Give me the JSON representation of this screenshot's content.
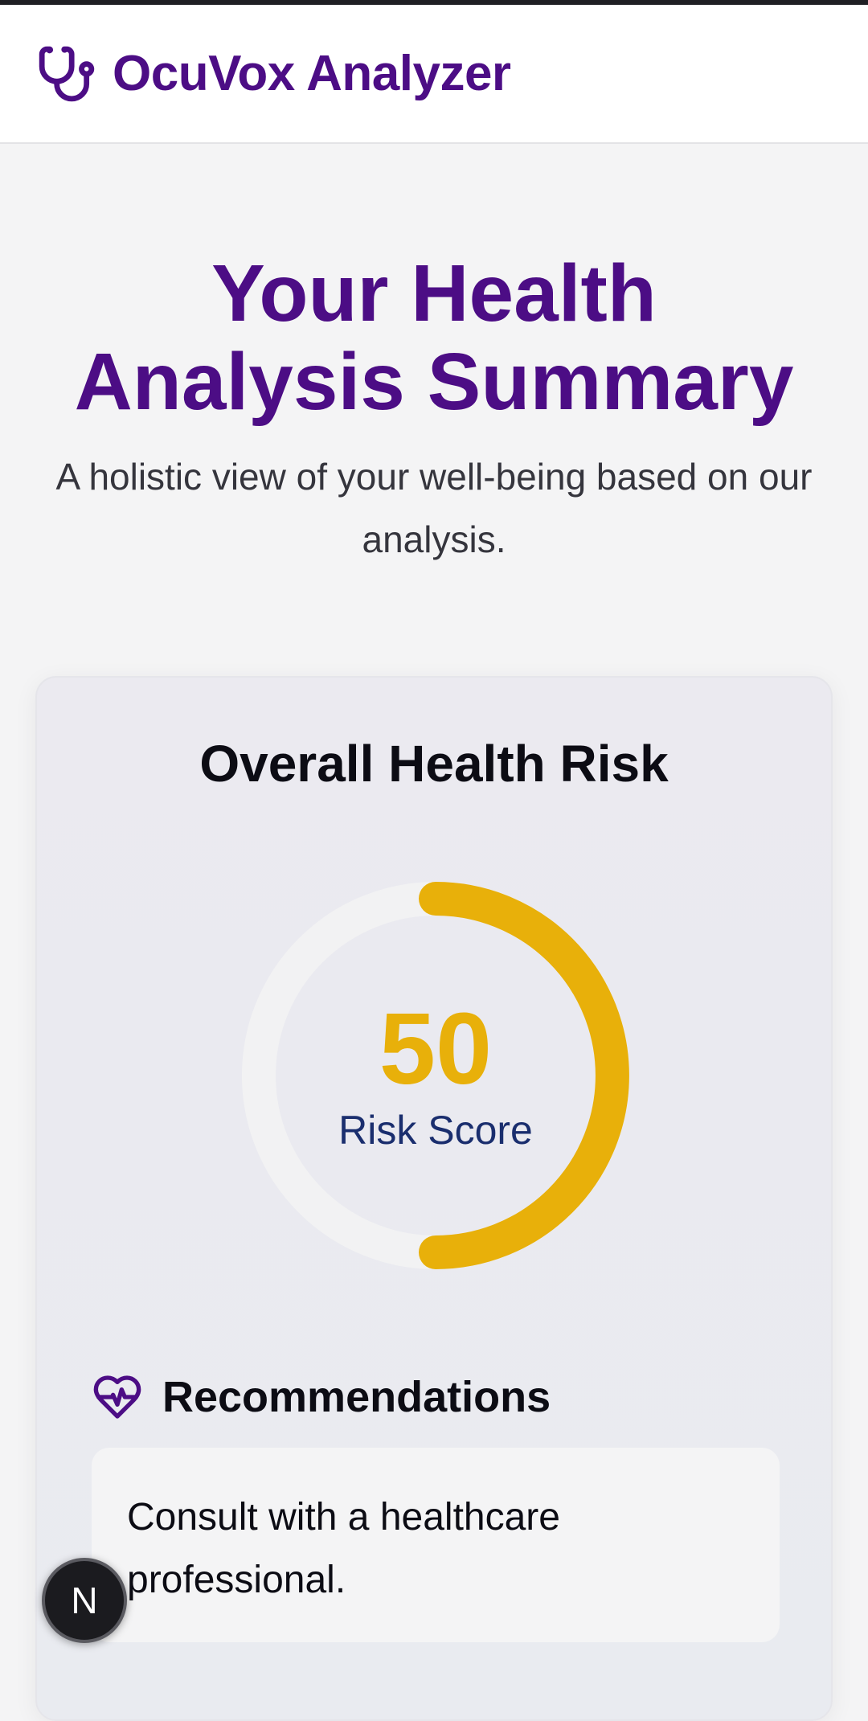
{
  "header": {
    "app_title": "OcuVox Analyzer",
    "logo_icon": "stethoscope-icon",
    "brand_color": "#4c0d85"
  },
  "hero": {
    "title_line1": "Your Health",
    "title_line2": "Analysis Summary",
    "subtitle": "A holistic view of your well-being based on our analysis."
  },
  "risk_card": {
    "title": "Overall Health Risk",
    "score": "50",
    "score_label": "Risk Score",
    "score_fraction": 0.5,
    "score_color": "#e8b00a"
  },
  "recommendations": {
    "title": "Recommendations",
    "icon": "heart-pulse-icon",
    "items": [
      "Consult with a healthcare professional."
    ]
  },
  "floating_button": {
    "label": "N"
  }
}
